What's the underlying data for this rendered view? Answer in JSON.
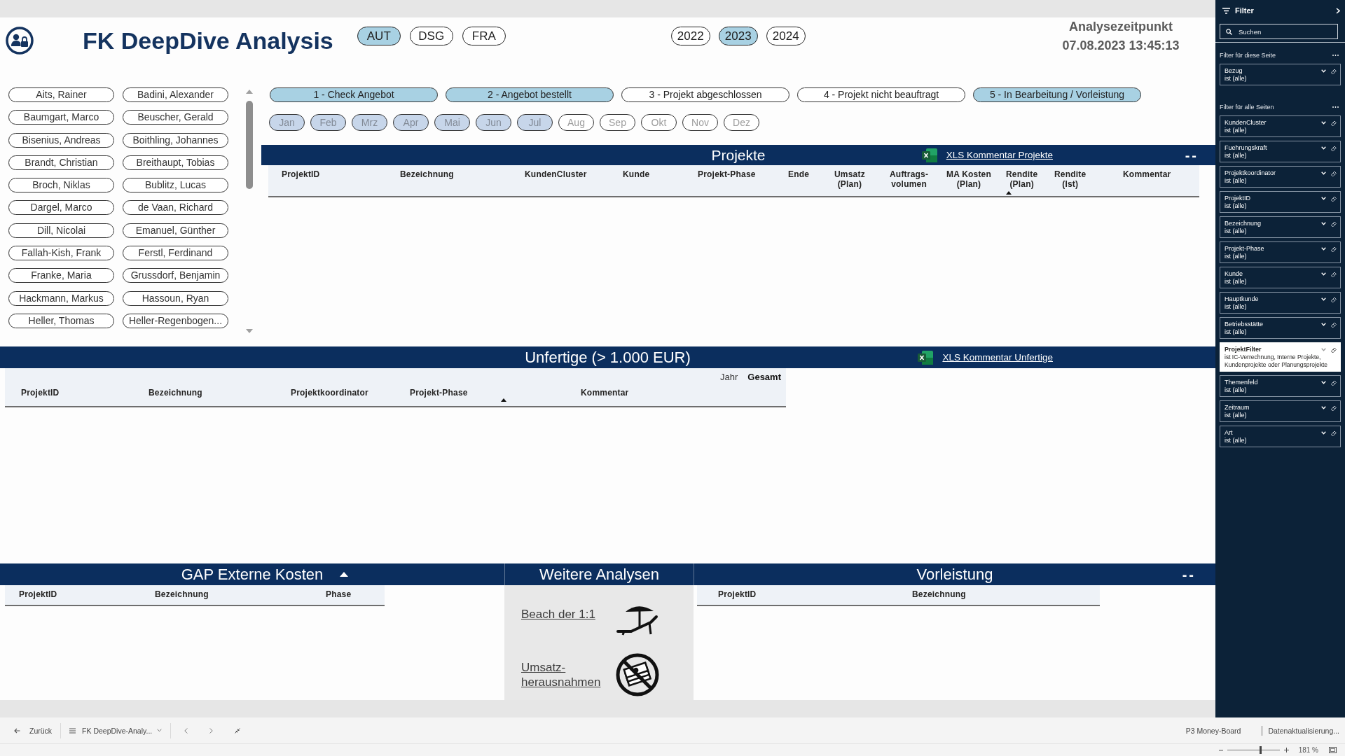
{
  "header": {
    "title": "FK DeepDive Analysis",
    "regions": [
      {
        "label": "AUT",
        "selected": true
      },
      {
        "label": "DSG",
        "selected": false
      },
      {
        "label": "FRA",
        "selected": false
      }
    ],
    "years": [
      {
        "label": "2022",
        "selected": false
      },
      {
        "label": "2023",
        "selected": true
      },
      {
        "label": "2024",
        "selected": false
      }
    ],
    "analysis_time": {
      "label": "Analysezeitpunkt",
      "value": "07.08.2023 13:45:13"
    }
  },
  "people": [
    {
      "name": "Aits, Rainer",
      "selected": false
    },
    {
      "name": "Badini, Alexander",
      "selected": false
    },
    {
      "name": "Baumgart, Marco",
      "selected": false
    },
    {
      "name": "Beuscher, Gerald",
      "selected": false
    },
    {
      "name": "Bisenius, Andreas",
      "selected": false
    },
    {
      "name": "Boithling, Johannes",
      "selected": false
    },
    {
      "name": "Brandt, Christian",
      "selected": false
    },
    {
      "name": "Breithaupt, Tobias",
      "selected": false
    },
    {
      "name": "Broch, Niklas",
      "selected": false
    },
    {
      "name": "Bublitz, Lucas",
      "selected": false
    },
    {
      "name": "Dargel, Marco",
      "selected": false
    },
    {
      "name": "de Vaan, Richard",
      "selected": false
    },
    {
      "name": "Dill, Nicolai",
      "selected": false
    },
    {
      "name": "Emanuel, Günther",
      "selected": false
    },
    {
      "name": "Fallah-Kish, Frank",
      "selected": false
    },
    {
      "name": "Ferstl, Ferdinand",
      "selected": false
    },
    {
      "name": "Franke, Maria",
      "selected": false
    },
    {
      "name": "Grussdorf, Benjamin",
      "selected": false
    },
    {
      "name": "Hackmann, Markus",
      "selected": false
    },
    {
      "name": "Hassoun, Ryan",
      "selected": false
    },
    {
      "name": "Heller, Thomas",
      "selected": false
    },
    {
      "name": "Heller-Regenbogen...",
      "selected": false
    }
  ],
  "phases": [
    {
      "label": "1 - Check Angebot",
      "selected": true
    },
    {
      "label": "2 - Angebot bestellt",
      "selected": true
    },
    {
      "label": "3 - Projekt abgeschlossen",
      "selected": false
    },
    {
      "label": "4 - Projekt nicht beauftragt",
      "selected": false
    },
    {
      "label": "5 - In Bearbeitung / Vorleistung",
      "selected": true
    }
  ],
  "months": [
    {
      "label": "Jan",
      "selected": true
    },
    {
      "label": "Feb",
      "selected": true
    },
    {
      "label": "Mrz",
      "selected": true
    },
    {
      "label": "Apr",
      "selected": true
    },
    {
      "label": "Mai",
      "selected": true
    },
    {
      "label": "Jun",
      "selected": true
    },
    {
      "label": "Jul",
      "selected": true
    },
    {
      "label": "Aug",
      "selected": false
    },
    {
      "label": "Sep",
      "selected": false
    },
    {
      "label": "Okt",
      "selected": false
    },
    {
      "label": "Nov",
      "selected": false
    },
    {
      "label": "Dez",
      "selected": false
    }
  ],
  "projects": {
    "title": "Projekte",
    "export_link": "XLS Kommentar Projekte",
    "dash_button": "--",
    "columns": [
      {
        "label": "ProjektID",
        "sorted": false
      },
      {
        "label": "Bezeichnung",
        "sorted": false
      },
      {
        "label": "KundenCluster",
        "sorted": false
      },
      {
        "label": "Kunde",
        "sorted": false
      },
      {
        "label": "Projekt-Phase",
        "sorted": false
      },
      {
        "label": "Ende",
        "sorted": false
      },
      {
        "label": "Umsatz\n(Plan)",
        "sorted": false
      },
      {
        "label": "Auftrags-\nvolumen",
        "sorted": false
      },
      {
        "label": "MA Kosten\n(Plan)",
        "sorted": false
      },
      {
        "label": "Rendite\n(Plan)",
        "sorted": true
      },
      {
        "label": "Rendite\n(Ist)",
        "sorted": false
      },
      {
        "label": "Kommentar",
        "sorted": false
      }
    ]
  },
  "unfinished": {
    "title": "Unfertige (> 1.000 EUR)",
    "export_link": "XLS Kommentar Unfertige",
    "columns": [
      {
        "label": "ProjektID",
        "sorted": false
      },
      {
        "label": "Bezeichnung",
        "sorted": false
      },
      {
        "label": "Projektkoordinator",
        "sorted": false
      },
      {
        "label": "Projekt-Phase",
        "sorted": true
      },
      {
        "label": "Kommentar",
        "sorted": false
      }
    ],
    "matrix_header": {
      "label": "Jahr",
      "value": "Gesamt"
    }
  },
  "gap_costs": {
    "title": "GAP Externe Kosten",
    "columns": [
      "ProjektID",
      "Bezeichnung",
      "Phase"
    ]
  },
  "further_analyses": {
    "title": "Weitere Analysen",
    "links": [
      {
        "label": "Beach der 1:1",
        "kind": "beach"
      },
      {
        "label": "Umsatz-\nherausnahmen",
        "kind": "no-money"
      }
    ]
  },
  "advance_work": {
    "title": "Vorleistung",
    "dash_button": "--",
    "columns": [
      "ProjektID",
      "Bezeichnung"
    ]
  },
  "filter_pane": {
    "title": "Filter",
    "search": {
      "placeholder": "Suchen"
    },
    "sections": [
      {
        "title": "Filter für diese Seite",
        "cards": [
          {
            "field": "Bezug",
            "value": "ist (alle)",
            "applied": false
          }
        ]
      },
      {
        "title": "Filter für alle Seiten",
        "cards": [
          {
            "field": "KundenCluster",
            "value": "ist (alle)",
            "applied": false
          },
          {
            "field": "Fuehrungskraft",
            "value": "ist (alle)",
            "applied": false
          },
          {
            "field": "Projektkoordinator",
            "value": "ist (alle)",
            "applied": false
          },
          {
            "field": "ProjektID",
            "value": "ist (alle)",
            "applied": false
          },
          {
            "field": "Bezeichnung",
            "value": "ist (alle)",
            "applied": false
          },
          {
            "field": "Projekt-Phase",
            "value": "ist (alle)",
            "applied": false
          },
          {
            "field": "Kunde",
            "value": "ist (alle)",
            "applied": false
          },
          {
            "field": "Hauptkunde",
            "value": "ist (alle)",
            "applied": false
          },
          {
            "field": "Betriebsstätte",
            "value": "ist (alle)",
            "applied": false
          },
          {
            "field": "ProjektFilter",
            "value": "ist IC-Verrechnung, Interne Projekte, Kundenprojekte oder Planungsprojekte",
            "applied": true
          },
          {
            "field": "Themenfeld",
            "value": "ist (alle)",
            "applied": false
          },
          {
            "field": "Zeitraum",
            "value": "ist (alle)",
            "applied": false
          },
          {
            "field": "Art",
            "value": "ist (alle)",
            "applied": false
          }
        ]
      }
    ]
  },
  "status_bar": {
    "back": "Zurück",
    "page": "FK DeepDive-Analy...",
    "report": "P3 Money-Board",
    "refresh": "Datenaktualisierung...",
    "zoom": {
      "level": 0.64,
      "reading": "181 %"
    }
  }
}
